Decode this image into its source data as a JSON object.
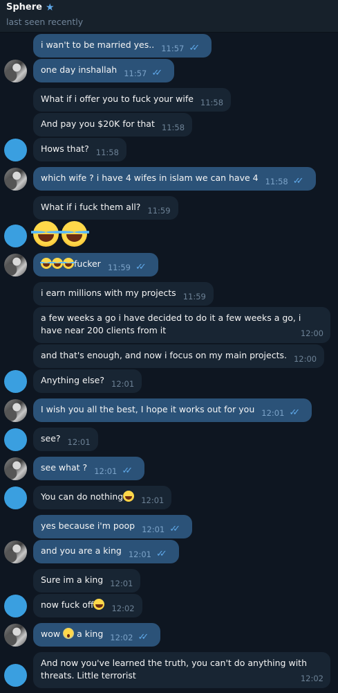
{
  "header": {
    "name": "Sphere",
    "star_icon": "star-icon",
    "status": "last seen recently"
  },
  "messages": [
    {
      "dir": "out",
      "text": "i wan't to be married yes..",
      "time": "11:57"
    },
    {
      "dir": "out",
      "text": "one day inshallah",
      "time": "11:57"
    },
    {
      "dir": "in",
      "text": "What if i offer you to fuck your wife",
      "time": "11:58"
    },
    {
      "dir": "in",
      "text": "And pay you $20K for that",
      "time": "11:58"
    },
    {
      "dir": "in",
      "text": "Hows that?",
      "time": "11:58"
    },
    {
      "dir": "out",
      "text": "which wife ? i have 4 wifes in islam we can have 4",
      "time": "11:58"
    },
    {
      "dir": "in",
      "text": "What if i fuck them all?",
      "time": "11:59"
    },
    {
      "dir": "in",
      "emoji": "face-with-tears-of-joy x2",
      "text": ""
    },
    {
      "dir": "out",
      "text": "fucker",
      "time": "11:59",
      "emoji": "face-with-tears-of-joy x3"
    },
    {
      "dir": "in",
      "text": "i earn millions with my projects",
      "time": "11:59"
    },
    {
      "dir": "in",
      "text": "a few weeks a go i have  decided to do it a few weeks a go, i have near 200 clients from it",
      "time": "12:00"
    },
    {
      "dir": "in",
      "text": "and that's enough, and now i focus on my main projects.",
      "time": "12:00"
    },
    {
      "dir": "in",
      "text": "Anything else?",
      "time": "12:01"
    },
    {
      "dir": "out",
      "text": "I wish you all the best, I hope it works out for you",
      "time": "12:01"
    },
    {
      "dir": "in",
      "text": "see?",
      "time": "12:01"
    },
    {
      "dir": "out",
      "text": "see what ?",
      "time": "12:01"
    },
    {
      "dir": "in",
      "text": "You can do nothing",
      "time": "12:01",
      "emoji": "grinning-squinting-face"
    },
    {
      "dir": "out",
      "text": "yes because i'm poop",
      "time": "12:01"
    },
    {
      "dir": "out",
      "text": "and you are a king",
      "time": "12:01"
    },
    {
      "dir": "in",
      "text": "Sure im a king",
      "time": "12:01"
    },
    {
      "dir": "in",
      "text": "now fuck off",
      "time": "12:02",
      "emoji": "grinning-squinting-face"
    },
    {
      "dir": "out",
      "text": "a king",
      "prefix": "wow",
      "time": "12:02",
      "emoji": "face-screaming-in-fear"
    },
    {
      "dir": "in",
      "text": "And now you've learned the truth, you can't do anything with threats. Little terrorist",
      "time": "12:02"
    }
  ],
  "colors": {
    "background": "#0e1621",
    "header": "#17212b",
    "incoming": "#182533",
    "outgoing": "#2b5278",
    "accent": "#5fa8e8"
  }
}
